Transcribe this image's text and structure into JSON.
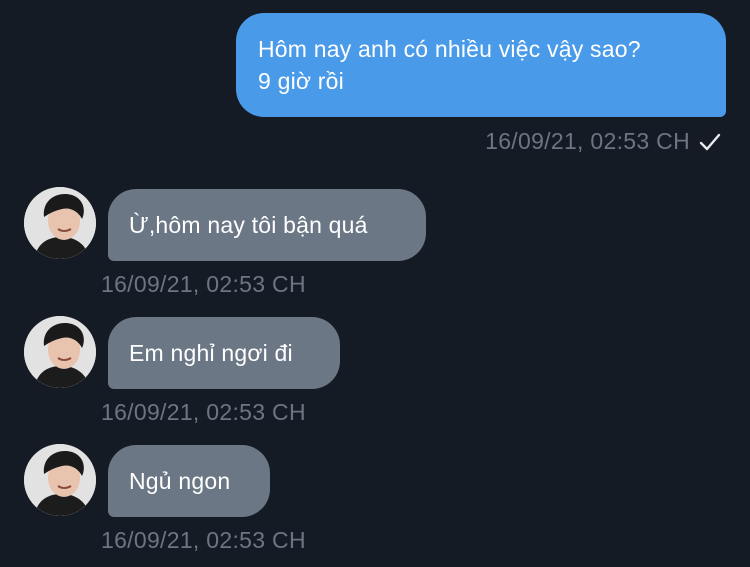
{
  "conversation": {
    "outgoing": {
      "text": "Hôm nay anh có nhiều việc vậy sao?\n9 giờ rồi",
      "timestamp": "16/09/21, 02:53 CH",
      "status_icon": "read-checkmark-icon"
    },
    "incoming": [
      {
        "text": "Ừ,hôm nay tôi bận quá",
        "timestamp": "16/09/21, 02:53 CH",
        "avatar_icon": "contact-avatar"
      },
      {
        "text": "Em nghỉ ngơi đi",
        "timestamp": "16/09/21, 02:53 CH",
        "avatar_icon": "contact-avatar"
      },
      {
        "text": "Ngủ ngon",
        "timestamp": "16/09/21, 02:53 CH",
        "avatar_icon": "contact-avatar"
      }
    ]
  },
  "colors": {
    "background": "#151b24",
    "outgoing_bubble": "#4a9aea",
    "incoming_bubble": "#6b7785",
    "timestamp_text": "#6c7683"
  }
}
